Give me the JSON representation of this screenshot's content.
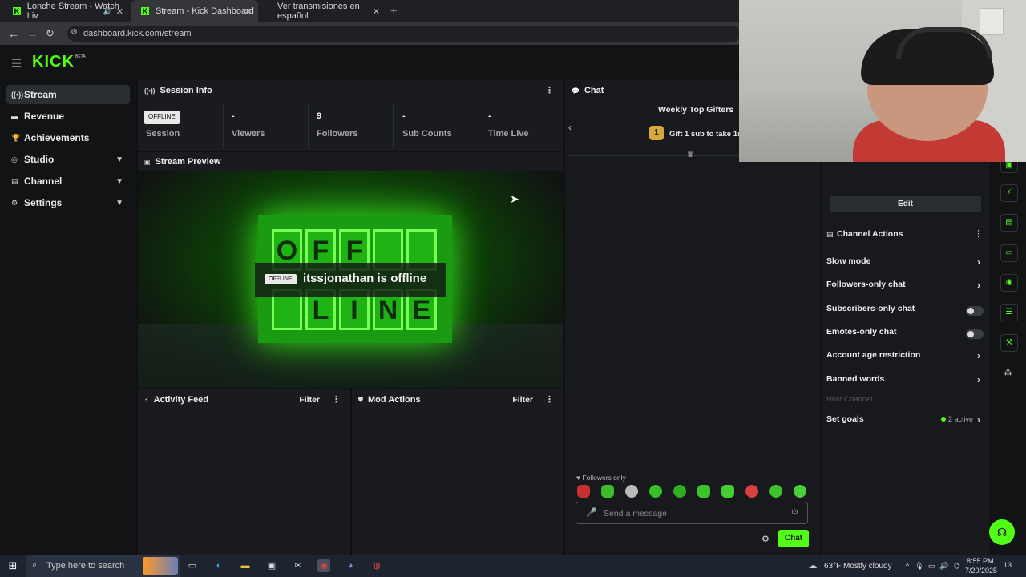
{
  "browser": {
    "tabs": [
      {
        "label": "Lonche Stream - Watch Liv"
      },
      {
        "label": "Stream - Kick Dashboard"
      },
      {
        "label": "Ver transmisiones en español"
      }
    ],
    "url": "dashboard.kick.com/stream"
  },
  "kick": {
    "logo": "KICK",
    "beta": "BETA"
  },
  "sidebar": {
    "items": [
      {
        "label": "Stream",
        "icon": "broadcast-icon"
      },
      {
        "label": "Revenue",
        "icon": "money-icon"
      },
      {
        "label": "Achievements",
        "icon": "trophy-icon"
      },
      {
        "label": "Studio",
        "icon": "studio-icon"
      },
      {
        "label": "Channel",
        "icon": "channel-icon"
      },
      {
        "label": "Settings",
        "icon": "gear-icon"
      }
    ]
  },
  "session": {
    "title": "Session Info",
    "status_badge": "OFFLINE",
    "stats": [
      {
        "value": "",
        "label": "Session"
      },
      {
        "value": "-",
        "label": "Viewers"
      },
      {
        "value": "9",
        "label": "Followers"
      },
      {
        "value": "-",
        "label": "Sub Counts"
      },
      {
        "value": "-",
        "label": "Time Live"
      }
    ]
  },
  "preview": {
    "title": "Stream Preview",
    "badge": "OFFLINE",
    "status_text": "itssjonathan is offline",
    "sign_row1": [
      "O",
      "F",
      "F",
      ""
    ],
    "sign_row2": [
      "",
      "L",
      "I",
      "N",
      "E"
    ]
  },
  "activity": {
    "title": "Activity Feed",
    "filter": "Filter"
  },
  "mod": {
    "title": "Mod Actions",
    "filter": "Filter"
  },
  "chat": {
    "title": "Chat",
    "top_gifters_title": "Weekly Top Gifters",
    "rank": "1",
    "gift_text": "Gift 1 sub to take 1st",
    "followers_only": "Followers only",
    "placeholder": "Send a message",
    "send_label": "Chat"
  },
  "channel": {
    "edit_label": "Edit",
    "actions_title": "Channel Actions",
    "rows": [
      {
        "label": "Slow mode"
      },
      {
        "label": "Followers-only chat"
      },
      {
        "label": "Subscribers-only chat"
      },
      {
        "label": "Emotes-only chat"
      },
      {
        "label": "Account age restriction"
      },
      {
        "label": "Banned words"
      },
      {
        "label": "Host Channel"
      },
      {
        "label": "Set goals"
      }
    ],
    "goals_active": "2 active"
  },
  "taskbar": {
    "search_placeholder": "Type here to search",
    "weather": "63°F  Mostly cloudy",
    "time": "8:55 PM",
    "date": "7/20/2025",
    "notifications": "13"
  },
  "colors": {
    "accent": "#53fc18",
    "background": "#0f1112",
    "panel": "#191b1f"
  }
}
